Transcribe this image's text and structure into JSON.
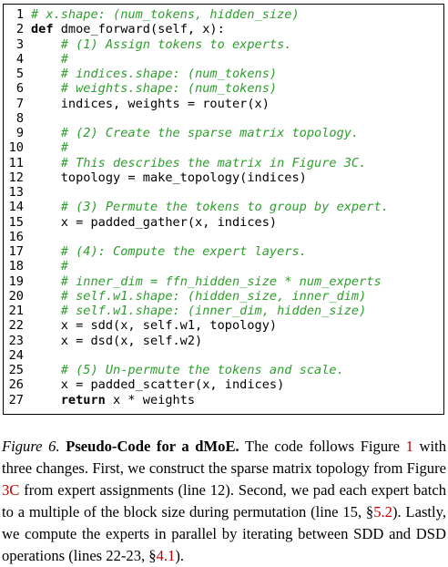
{
  "code_lines": [
    {
      "n": "1",
      "parts": [
        {
          "t": "# x.shape: (num_tokens, hidden_size)",
          "cls": "c"
        }
      ]
    },
    {
      "n": "2",
      "parts": [
        {
          "t": "def",
          "cls": "k"
        },
        {
          "t": " dmoe_forward(self, x):",
          "cls": ""
        }
      ]
    },
    {
      "n": "3",
      "parts": [
        {
          "t": "    ",
          "cls": ""
        },
        {
          "t": "# (1) Assign tokens to experts.",
          "cls": "c"
        }
      ]
    },
    {
      "n": "4",
      "parts": [
        {
          "t": "    ",
          "cls": ""
        },
        {
          "t": "#",
          "cls": "c"
        }
      ]
    },
    {
      "n": "5",
      "parts": [
        {
          "t": "    ",
          "cls": ""
        },
        {
          "t": "# indices.shape: (num_tokens)",
          "cls": "c"
        }
      ]
    },
    {
      "n": "6",
      "parts": [
        {
          "t": "    ",
          "cls": ""
        },
        {
          "t": "# weights.shape: (num_tokens)",
          "cls": "c"
        }
      ]
    },
    {
      "n": "7",
      "parts": [
        {
          "t": "    indices, weights = router(x)",
          "cls": ""
        }
      ]
    },
    {
      "n": "8",
      "parts": []
    },
    {
      "n": "9",
      "parts": [
        {
          "t": "    ",
          "cls": ""
        },
        {
          "t": "# (2) Create the sparse matrix topology.",
          "cls": "c"
        }
      ]
    },
    {
      "n": "10",
      "parts": [
        {
          "t": "    ",
          "cls": ""
        },
        {
          "t": "#",
          "cls": "c"
        }
      ]
    },
    {
      "n": "11",
      "parts": [
        {
          "t": "    ",
          "cls": ""
        },
        {
          "t": "# This describes the matrix in Figure 3C.",
          "cls": "c"
        }
      ]
    },
    {
      "n": "12",
      "parts": [
        {
          "t": "    topology = make_topology(indices)",
          "cls": ""
        }
      ]
    },
    {
      "n": "13",
      "parts": []
    },
    {
      "n": "14",
      "parts": [
        {
          "t": "    ",
          "cls": ""
        },
        {
          "t": "# (3) Permute the tokens to group by expert.",
          "cls": "c"
        }
      ]
    },
    {
      "n": "15",
      "parts": [
        {
          "t": "    x = padded_gather(x, indices)",
          "cls": ""
        }
      ]
    },
    {
      "n": "16",
      "parts": []
    },
    {
      "n": "17",
      "parts": [
        {
          "t": "    ",
          "cls": ""
        },
        {
          "t": "# (4): Compute the expert layers.",
          "cls": "c"
        }
      ]
    },
    {
      "n": "18",
      "parts": [
        {
          "t": "    ",
          "cls": ""
        },
        {
          "t": "#",
          "cls": "c"
        }
      ]
    },
    {
      "n": "19",
      "parts": [
        {
          "t": "    ",
          "cls": ""
        },
        {
          "t": "# inner_dim = ffn_hidden_size * num_experts",
          "cls": "c"
        }
      ]
    },
    {
      "n": "20",
      "parts": [
        {
          "t": "    ",
          "cls": ""
        },
        {
          "t": "# self.w1.shape: (hidden_size, inner_dim)",
          "cls": "c"
        }
      ]
    },
    {
      "n": "21",
      "parts": [
        {
          "t": "    ",
          "cls": ""
        },
        {
          "t": "# self.w1.shape: (inner_dim, hidden_size)",
          "cls": "c"
        }
      ]
    },
    {
      "n": "22",
      "parts": [
        {
          "t": "    x = sdd(x, self.w1, topology)",
          "cls": ""
        }
      ]
    },
    {
      "n": "23",
      "parts": [
        {
          "t": "    x = dsd(x, self.w2)",
          "cls": ""
        }
      ]
    },
    {
      "n": "24",
      "parts": []
    },
    {
      "n": "25",
      "parts": [
        {
          "t": "    ",
          "cls": ""
        },
        {
          "t": "# (5) Un-permute the tokens and scale.",
          "cls": "c"
        }
      ]
    },
    {
      "n": "26",
      "parts": [
        {
          "t": "    x = padded_scatter(x, indices)",
          "cls": ""
        }
      ]
    },
    {
      "n": "27",
      "parts": [
        {
          "t": "    ",
          "cls": ""
        },
        {
          "t": "return",
          "cls": "k"
        },
        {
          "t": " x * weights",
          "cls": ""
        }
      ]
    }
  ],
  "caption": {
    "label": "Figure 6.",
    "title": "Pseudo-Code for a dMoE.",
    "text_1": " The code follows Figure ",
    "ref_fig1": "1",
    "text_2": " with three changes. First, we construct the sparse matrix topology from Figure ",
    "ref_fig3c": "3C",
    "text_3": " from expert assignments (line 12). Second, we pad each expert batch to a multiple of the block size during permutation (line 15, §",
    "ref_sec52": "5.2",
    "text_4": "). Lastly, we compute the experts in parallel by iterating between SDD and DSD operations (lines 22-23, §",
    "ref_sec41": "4.1",
    "text_5": ")."
  }
}
